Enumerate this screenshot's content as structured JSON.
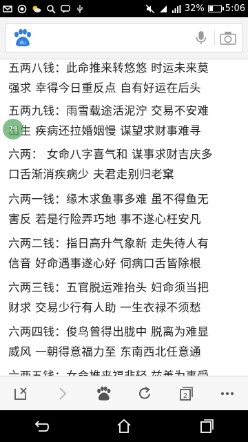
{
  "status_bar": {
    "battery_percent_text": "32%",
    "battery_level": 0.32,
    "time": "5:06",
    "icons": [
      "mail-icon",
      "sync-icon",
      "weather-cloud-icon",
      "search-icon",
      "chat-icon",
      "usb-icon",
      "mute-icon",
      "wifi-icon",
      "signal-icon",
      "battery-icon"
    ]
  },
  "search": {
    "value": "",
    "placeholder": "",
    "logo": "baidu-paw-logo",
    "logo_text": "du",
    "accent": "#2f7fe0"
  },
  "content": {
    "lines": [
      "    五两八钱：此命推来转悠悠  时运未来莫",
      "强求 幸得今日重反点 自有好运在后头",
      "    五两九钱：雨雪载途活泥泞  交易不安难",
      "出生 疾病还拉婚姻慢 谋望求财事难寻",
      "    六两：  女命八字喜气和 谋事求财吉庆多",
      "口舌渐消疾病少 夫君走别归老窠",
      "    六两一钱：缘木求鱼事多难  虽不得鱼无",
      "害反 若是行险弄巧地 事不遂心枉安凡",
      "    六两二钱：指日高升气象新  走失待人有",
      "信音 好命遇事遂心好 伺病口舌皆除根",
      "    六两三钱：五官脱运难抬头  妇命须当把",
      "财求 交易少行有人助 一生衣禄不须愁",
      "    六两四钱：俊鸟曾得出胧中  脱离为难显",
      "威风 一朝得意福力至 东南西北任意通",
      "    六两五钱：女命推来福非轻  兹善为事受"
    ],
    "floating_badge": "79"
  },
  "toolbar": {
    "tab_count": "2",
    "buttons": [
      "close-page-icon",
      "forward-icon",
      "baidu-home-icon",
      "refresh-icon",
      "tabs-icon",
      "more-icon"
    ]
  },
  "navbar": {
    "buttons": [
      "back-icon",
      "home-icon",
      "recent-apps-icon"
    ]
  }
}
